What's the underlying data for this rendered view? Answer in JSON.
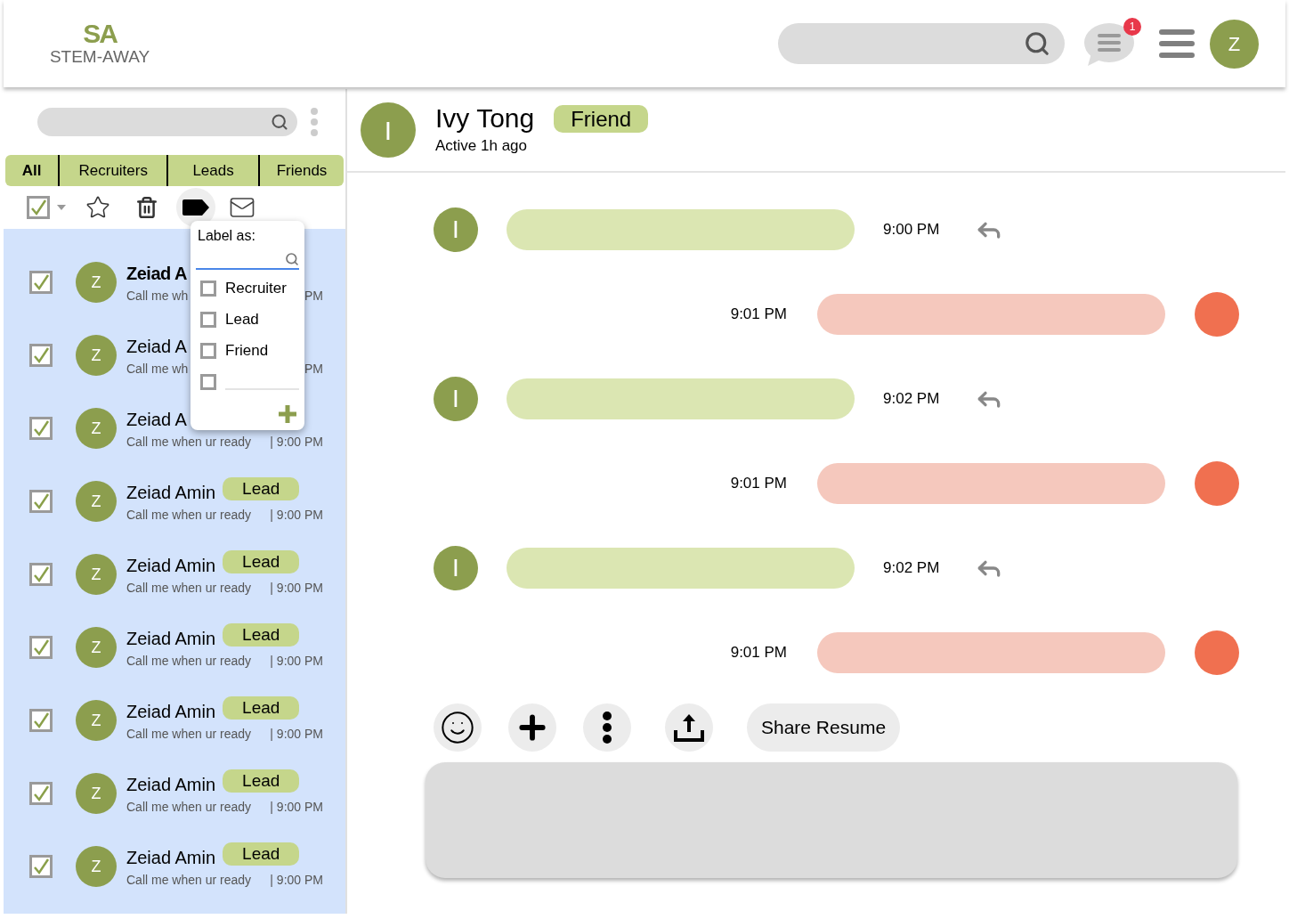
{
  "logo": {
    "mark": "SA",
    "name": "STEM-AWAY"
  },
  "header": {
    "notification_count": "1",
    "user_initial": "Z"
  },
  "tabs": [
    {
      "label": "All",
      "selected": true
    },
    {
      "label": "Recruiters",
      "selected": false
    },
    {
      "label": "Leads",
      "selected": false
    },
    {
      "label": "Friends",
      "selected": false
    }
  ],
  "select_all": {
    "checked": true
  },
  "conversations": [
    {
      "initial": "Z",
      "name": "Zeiad A",
      "unread": true,
      "checked": true,
      "preview": "Call me wh",
      "time": "PM"
    },
    {
      "initial": "Z",
      "name": "Zeiad A",
      "unread": false,
      "checked": true,
      "preview": "Call me wh",
      "time": "PM"
    },
    {
      "initial": "Z",
      "name": "Zeiad A",
      "unread": false,
      "checked": true,
      "preview": "Call me when ur ready",
      "time": "| 9:00 PM"
    },
    {
      "initial": "Z",
      "name": "Zeiad Amin",
      "unread": false,
      "checked": true,
      "badge": "Lead",
      "preview": "Call me when ur ready",
      "time": "| 9:00 PM"
    },
    {
      "initial": "Z",
      "name": "Zeiad Amin",
      "unread": false,
      "checked": true,
      "badge": "Lead",
      "preview": "Call me when ur ready",
      "time": "| 9:00 PM"
    },
    {
      "initial": "Z",
      "name": "Zeiad Amin",
      "unread": false,
      "checked": true,
      "badge": "Lead",
      "preview": "Call me when ur ready",
      "time": "| 9:00 PM"
    },
    {
      "initial": "Z",
      "name": "Zeiad Amin",
      "unread": false,
      "checked": true,
      "badge": "Lead",
      "preview": "Call me when ur ready",
      "time": "| 9:00 PM"
    },
    {
      "initial": "Z",
      "name": "Zeiad Amin",
      "unread": false,
      "checked": true,
      "badge": "Lead",
      "preview": "Call me when ur ready",
      "time": "| 9:00 PM"
    },
    {
      "initial": "Z",
      "name": "Zeiad Amin",
      "unread": false,
      "checked": true,
      "badge": "Lead",
      "preview": "Call me when ur ready",
      "time": "| 9:00 PM"
    }
  ],
  "label_menu": {
    "title": "Label as:",
    "options": [
      {
        "label": "Recruiter",
        "checked": false
      },
      {
        "label": "Lead",
        "checked": false
      },
      {
        "label": "Friend",
        "checked": false
      }
    ],
    "custom_option": {
      "checked": false
    }
  },
  "chat": {
    "initial": "I",
    "name": "Ivy Tong",
    "badge": "Friend",
    "status": "Active 1h ago",
    "messages": [
      {
        "kind": "incoming",
        "initial": "I",
        "time": "9:00 PM"
      },
      {
        "kind": "outgoing",
        "time": "9:01 PM"
      },
      {
        "kind": "incoming",
        "initial": "I",
        "time": "9:02 PM"
      },
      {
        "kind": "outgoing",
        "time": "9:01 PM"
      },
      {
        "kind": "incoming",
        "initial": "I",
        "time": "9:02 PM"
      },
      {
        "kind": "outgoing",
        "time": "9:01 PM"
      }
    ],
    "share_button": "Share Resume"
  }
}
